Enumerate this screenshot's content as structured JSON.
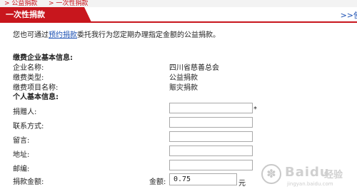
{
  "breadcrumb": {
    "items": [
      "> 公益捐款",
      "> 一次性捐款"
    ]
  },
  "tab": {
    "title": "一次性捐款",
    "more": ">>使"
  },
  "intro": {
    "prefix": "您也可通过",
    "link": "预约捐款",
    "suffix": "委托我行为您定期办理指定金额的公益捐款。"
  },
  "corp_section": {
    "title": "缴费企业基本信息:",
    "rows": [
      {
        "label": "企业名称:",
        "value": "四川省慈善总会"
      },
      {
        "label": "缴费类型:",
        "value": "公益捐款"
      },
      {
        "label": "缴费项目名称:",
        "value": "赈灾捐款"
      }
    ]
  },
  "personal_section": {
    "title": "个人基本信息:",
    "fields": [
      {
        "label": "捐赠人:",
        "value": "",
        "required": "*"
      },
      {
        "label": "联系方式:",
        "value": ""
      },
      {
        "label": "留言:",
        "value": ""
      },
      {
        "label": "地址:",
        "value": ""
      },
      {
        "label": "邮编:",
        "value": ""
      }
    ]
  },
  "amount": {
    "label": "捐款金额:",
    "field_label": "金额:",
    "value": "0.75",
    "unit": "元"
  },
  "watermark": {
    "text": "Bai",
    "badge": "du",
    "cn": "经验",
    "url": "jingyan.baidu.com"
  }
}
